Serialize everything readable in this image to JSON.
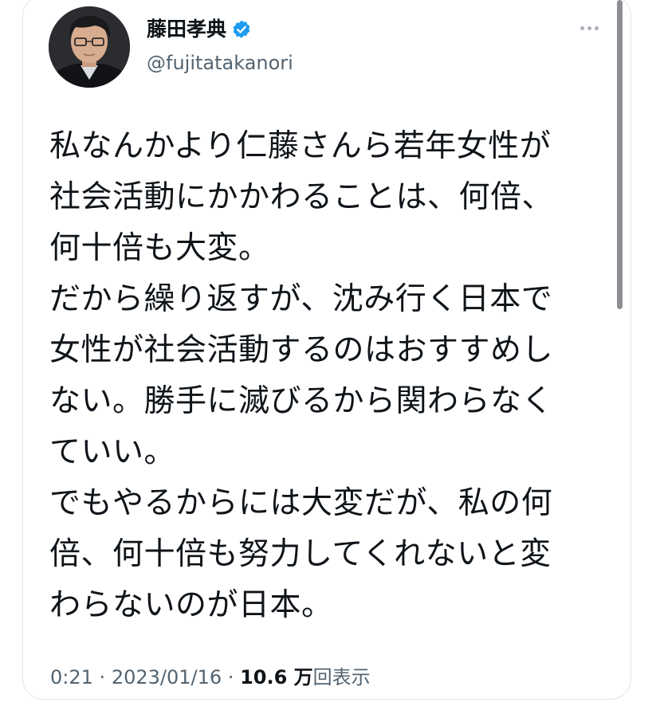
{
  "author": {
    "display_name": "藤田孝典",
    "handle": "@fujitatakanori",
    "verified": true
  },
  "tweet": {
    "text": "私なんかより仁藤さんら若年女性が\n社会活動にかかわることは、何倍、\n何十倍も大変。\nだから繰り返すが、沈み行く日本で\n女性が社会活動するのはおすすめし\nない。勝手に滅びるから関わらなく\nていい。\nでもやるからには大変だが、私の何\n倍、何十倍も努力してくれないと変\nわらないのが日本。",
    "time": "0:21",
    "separator": "·",
    "date": "2023/01/16",
    "view_count": "10.6 万",
    "view_label": "回表示"
  },
  "icons": {
    "verified": "verified-badge-icon",
    "more": "more-options-icon"
  },
  "colors": {
    "verified_blue": "#1d9bf0",
    "secondary_text": "#536471",
    "primary_text": "#0f1419",
    "border": "#e3e6ea"
  }
}
